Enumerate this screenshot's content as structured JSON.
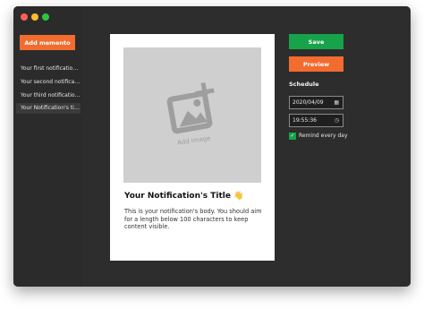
{
  "sidebar": {
    "add_button_label": "Add memento",
    "items": [
      {
        "label": "Your first notification..."
      },
      {
        "label": "Your second notificat..."
      },
      {
        "label": "Your third notification..."
      },
      {
        "label": "Your Notification's tit..."
      }
    ]
  },
  "card": {
    "image_placeholder_label": "Add image",
    "title": "Your Notification's Title",
    "title_emoji": "👋",
    "body": "This is your notification's body. You should aim for a length below 100 characters to keep content visible."
  },
  "actions": {
    "save_label": "Save",
    "preview_label": "Preview"
  },
  "schedule": {
    "label": "Schedule",
    "date_value": "2020/04/09",
    "time_value": "19:55:36",
    "remind_label": "Remind every day",
    "remind_checked": true
  },
  "colors": {
    "accent_orange": "#f26b2f",
    "accent_green": "#16a34a",
    "window_bg": "#2d2d2d"
  },
  "icons": {
    "add_image": "image-plus-icon",
    "calendar": "calendar-icon",
    "clock": "clock-icon",
    "check": "check-icon"
  }
}
